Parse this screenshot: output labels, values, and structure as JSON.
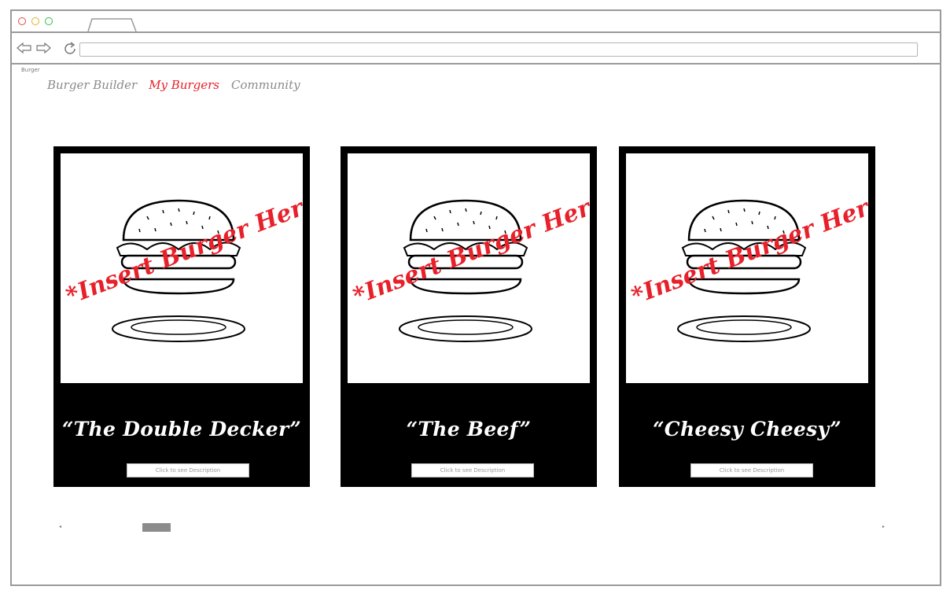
{
  "browser": {
    "page_label": "Burger",
    "address_value": ""
  },
  "nav": {
    "items": [
      {
        "label": "Burger Builder",
        "active": false
      },
      {
        "label": "My Burgers",
        "active": true
      },
      {
        "label": "Community",
        "active": false
      }
    ]
  },
  "cards": [
    {
      "title": "“The Double Decker”",
      "placeholder": "*Insert Burger Here",
      "button_label": "Click to see Description"
    },
    {
      "title": "“The Beef”",
      "placeholder": "*Insert Burger Here",
      "button_label": "Click to see Description"
    },
    {
      "title": "“Cheesy Cheesy”",
      "placeholder": "*Insert Burger Here",
      "button_label": "Click to see Description"
    }
  ],
  "scrollbar": {
    "left_arrow": "◂",
    "right_arrow": "▸"
  },
  "colors": {
    "accent": "#e8202a",
    "nav_inactive": "#8a8a8a",
    "card_bg": "#000000",
    "browser_border": "#9a9a9a"
  },
  "icons": [
    "back-arrow-icon",
    "forward-arrow-icon",
    "reload-icon",
    "burger-illustration-icon",
    "plate-icon"
  ]
}
